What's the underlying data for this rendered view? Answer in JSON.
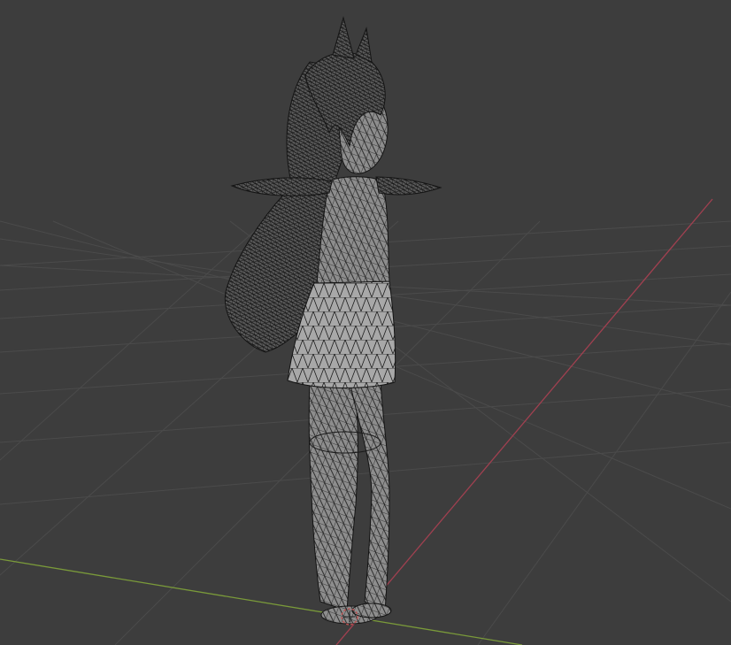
{
  "viewport": {
    "background_color": "#3d3d3d",
    "grid_line_color": "#4d4d4d",
    "x_axis_color": "#a04050",
    "y_axis_color": "#7a9a3a",
    "mesh_fill_color": "#8a8a8a",
    "wire_color": "#141414",
    "hair_color": "#222222",
    "origin_marker_color": "#c05050"
  },
  "scene": {
    "object": "character-mesh",
    "display_mode": "wireframe-overlay",
    "pose": "t-pose"
  }
}
